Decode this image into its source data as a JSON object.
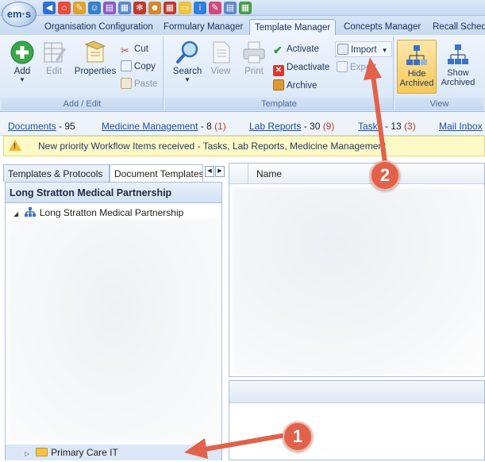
{
  "app": {
    "logo_text": "em·s"
  },
  "quick_access": {
    "icons": [
      "back-icon",
      "home-icon",
      "pencil-icon",
      "users-icon",
      "notes-icon",
      "calendar-icon",
      "molecule-icon",
      "people-icon",
      "grid-icon",
      "note-icon",
      "info-icon",
      "pen-icon",
      "document-icon",
      "table-icon"
    ],
    "colors": [
      "#2f6fd0",
      "#e64a3a",
      "#e0a32a",
      "#3a80c9",
      "#8a5ac6",
      "#5b88c8",
      "#c0392b",
      "#d4882d",
      "#c0392b",
      "#f0c23a",
      "#2f7fd8",
      "#d04b7a",
      "#5b88c8",
      "#4a9a4a"
    ]
  },
  "tabs": [
    {
      "label": "Organisation Configuration",
      "active": false
    },
    {
      "label": "Formulary Manager",
      "active": false
    },
    {
      "label": "Template Manager",
      "active": true
    },
    {
      "label": "Concepts Manager",
      "active": false
    },
    {
      "label": "Recall Sched",
      "active": false
    }
  ],
  "ribbon": {
    "add_edit": {
      "label": "Add / Edit",
      "add": "Add",
      "edit": "Edit",
      "properties": "Properties",
      "cut": "Cut",
      "copy": "Copy",
      "paste": "Paste"
    },
    "template": {
      "label": "Template",
      "search": "Search",
      "view": "View",
      "print": "Print",
      "activate": "Activate",
      "deactivate": "Deactivate",
      "archive": "Archive",
      "import": "Import",
      "export": "Export"
    },
    "view": {
      "label": "View",
      "hide_archived_1": "Hide",
      "hide_archived_2": "Archived",
      "show_archived_1": "Show",
      "show_archived_2": "Archived"
    }
  },
  "links": [
    {
      "label": "Documents",
      "count": " - 95",
      "extra": ""
    },
    {
      "label": "Medicine Management",
      "count": " - 8",
      "extra": "(1)"
    },
    {
      "label": "Lab Reports",
      "count": " - 30",
      "extra": "(9)"
    },
    {
      "label": "Tasks",
      "count": " - 13",
      "extra": "(3)"
    },
    {
      "label": "Mail Inbox",
      "count": "",
      "extra": ""
    }
  ],
  "notification": {
    "text": "New priority Workflow Items received - Tasks, Lab Reports, Medicine Management"
  },
  "left_panel": {
    "tabs": [
      "Templates & Protocols",
      "Document Templates"
    ],
    "header": "Long Stratton Medical Partnership",
    "tree_root": "Long Stratton Medical Partnership",
    "bottom_item": "Primary Care IT"
  },
  "right_panel": {
    "column_name": "Name"
  },
  "callouts": {
    "one": "1",
    "two": "2"
  }
}
